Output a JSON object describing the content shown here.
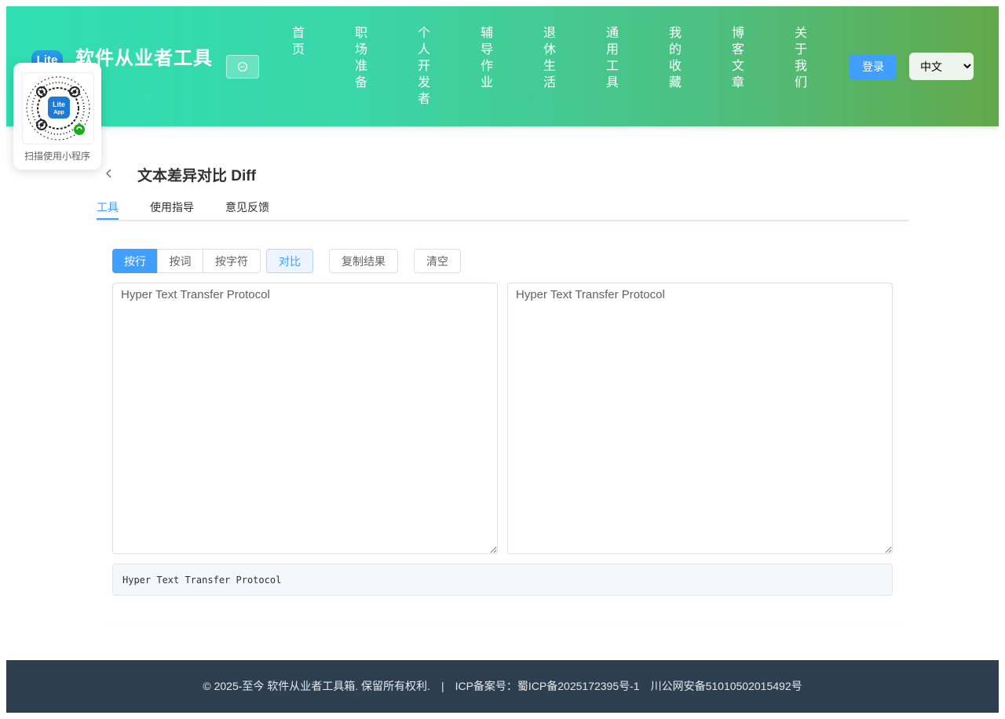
{
  "header": {
    "logo_text": "Lite",
    "site_title": "软件从业者工具",
    "nav": [
      {
        "label": "首页"
      },
      {
        "label": "职场准备"
      },
      {
        "label": "个人开发者"
      },
      {
        "label": "辅导作业"
      },
      {
        "label": "退休生活"
      },
      {
        "label": "通用工具"
      },
      {
        "label": "我的收藏"
      },
      {
        "label": "博客文章"
      },
      {
        "label": "关于我们"
      }
    ],
    "login_label": "登录",
    "language": {
      "selected": "中文"
    }
  },
  "qr_card": {
    "badge_line1": "Lite",
    "badge_line2": "App",
    "caption": "扫描使用小程序"
  },
  "page": {
    "title": "文本差异对比 Diff",
    "tabs": [
      {
        "label": "工具",
        "active": true
      },
      {
        "label": "使用指导",
        "active": false
      },
      {
        "label": "意见反馈",
        "active": false
      }
    ]
  },
  "tool": {
    "modes": [
      {
        "label": "按行",
        "active": true
      },
      {
        "label": "按词",
        "active": false
      },
      {
        "label": "按字符",
        "active": false
      }
    ],
    "compare_label": "对比",
    "copy_label": "复制结果",
    "clear_label": "清空",
    "left_text": "Hyper Text Transfer Protocol",
    "right_text": "Hyper Text Transfer Protocol",
    "result_text": "Hyper Text Transfer Protocol"
  },
  "footer": {
    "copyright": "© 2025-至今 软件从业者工具箱. 保留所有权利.",
    "separator": "|",
    "icp": "ICP备案号：蜀ICP备2025172395号-1",
    "police": "川公网安备51010502015492号"
  },
  "colors": {
    "primary": "#409eff",
    "header_gradient_start": "#2fdfb2",
    "header_gradient_end": "#63a84a",
    "footer_bg": "#2c3e50"
  }
}
